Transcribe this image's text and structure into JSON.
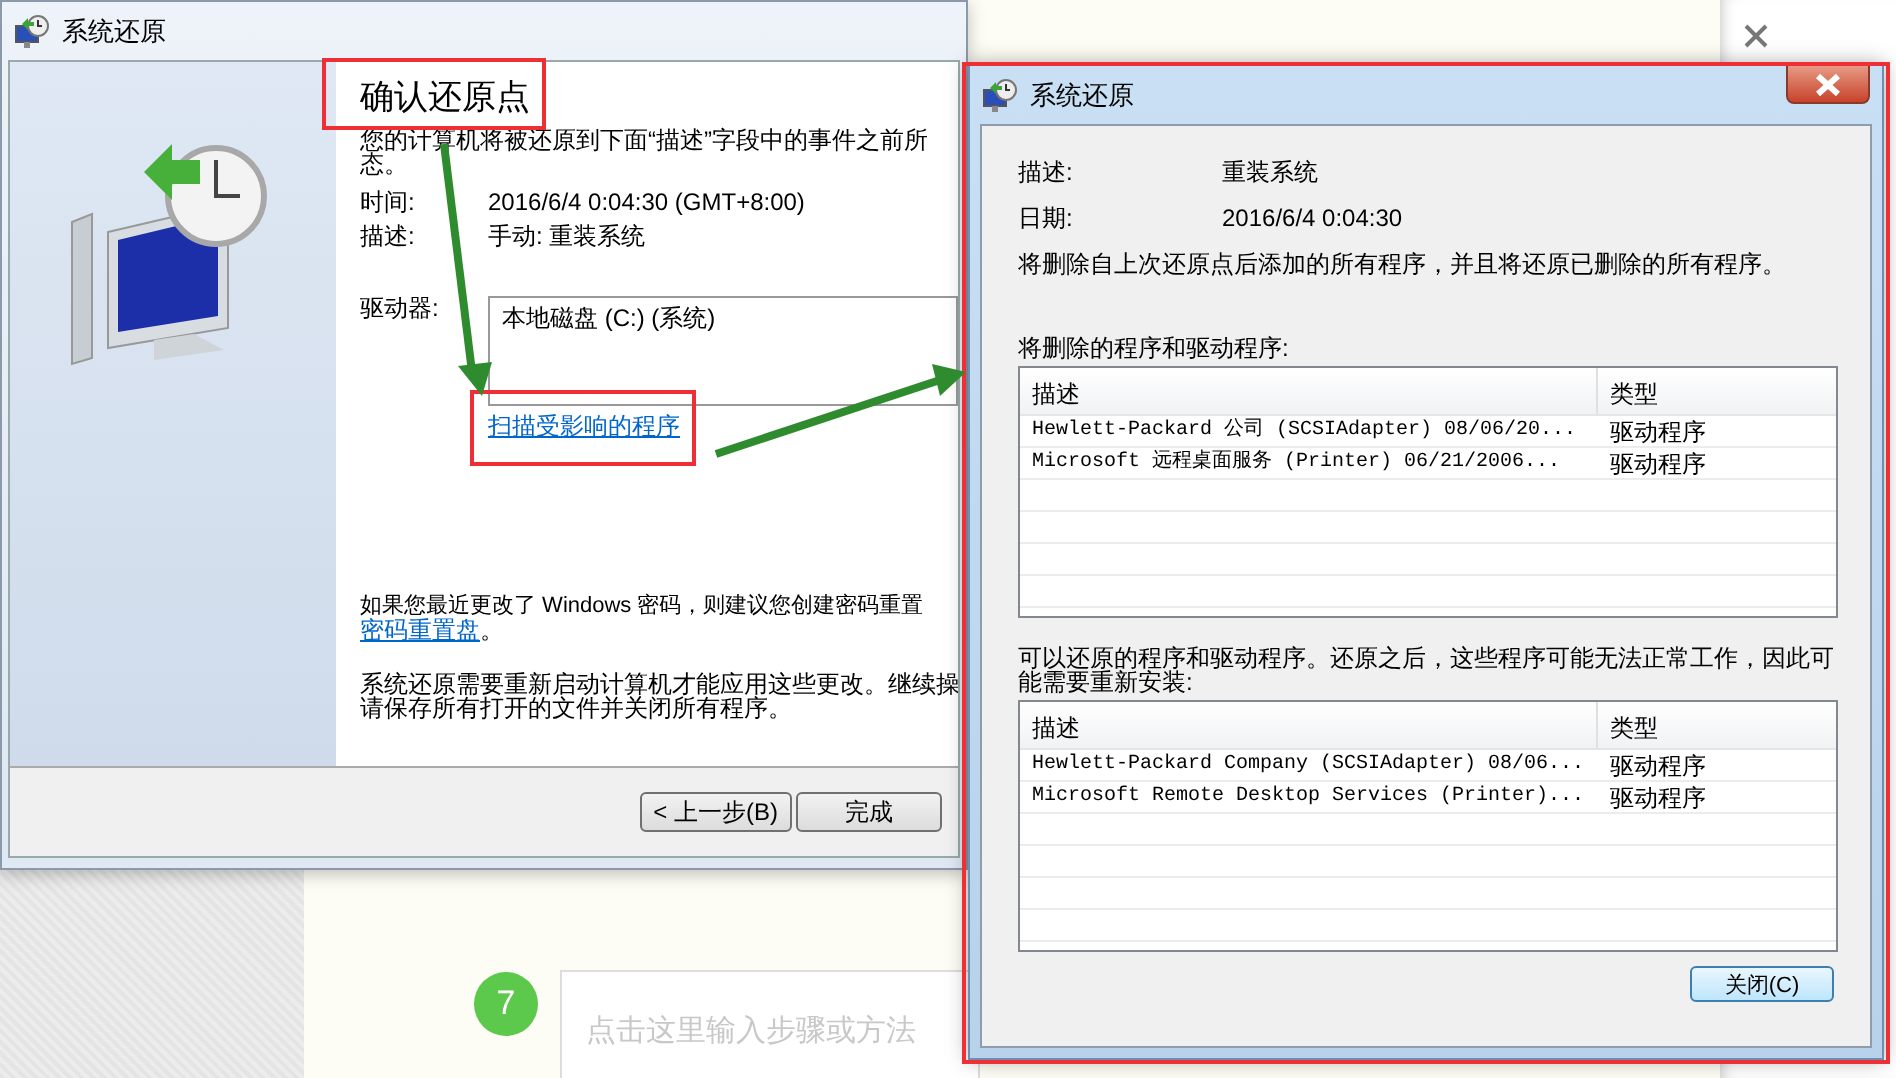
{
  "background": {
    "step_number": "7",
    "step_field": {
      "placeholder": "点击这里输入步骤或方法"
    }
  },
  "restore_window": {
    "title": "系统还原",
    "heading": "确认还原点",
    "intro_lines": [
      "您的计算机将被还原到下面“描述”字段中的事件之前所",
      "态。"
    ],
    "fields": [
      {
        "label": "时间:",
        "value": "2016/6/4 0:04:30 (GMT+8:00)"
      },
      {
        "label": "描述:",
        "value": "手动: 重装系统"
      }
    ],
    "drives": {
      "label": "驱动器:",
      "items": [
        "本地磁盘 (C:) (系统)"
      ]
    },
    "scan_link": "扫描受影响的程序",
    "password_note": {
      "text": "如果您最近更改了 Windows 密码，则建议您创建密码重置",
      "link": "密码重置盘",
      "tail": "。"
    },
    "restart_lines": [
      "系统还原需要重新启动计算机才能应用这些更改。继续操",
      "请保存所有打开的文件并关闭所有程序。"
    ],
    "buttons": [
      {
        "label": "< 上一步(B)"
      },
      {
        "label": "完成"
      }
    ]
  },
  "affected_window": {
    "title": "系统还原",
    "fields": [
      {
        "label": "描述:",
        "value": "重装系统"
      },
      {
        "label": "日期:",
        "value": "2016/6/4 0:04:30"
      }
    ],
    "note": "将删除自上次还原点后添加的所有程序，并且将还原已删除的所有程序。",
    "lists": [
      {
        "caption": "将删除的程序和驱动程序:",
        "columns": [
          "描述",
          "类型"
        ],
        "rows": [
          [
            "Hewlett-Packard 公司 (SCSIAdapter) 08/06/20...",
            "驱动程序"
          ],
          [
            "Microsoft 远程桌面服务 (Printer) 06/21/2006...",
            "驱动程序"
          ]
        ]
      },
      {
        "caption": "可以还原的程序和驱动程序。还原之后，这些程序可能无法正常工作，因此可能需要重新安装:",
        "columns": [
          "描述",
          "类型"
        ],
        "rows": [
          [
            "Hewlett-Packard Company (SCSIAdapter) 08/06...",
            "驱动程序"
          ],
          [
            "Microsoft Remote Desktop Services (Printer)...",
            "驱动程序"
          ]
        ]
      }
    ],
    "close_button": "关闭(C)"
  }
}
